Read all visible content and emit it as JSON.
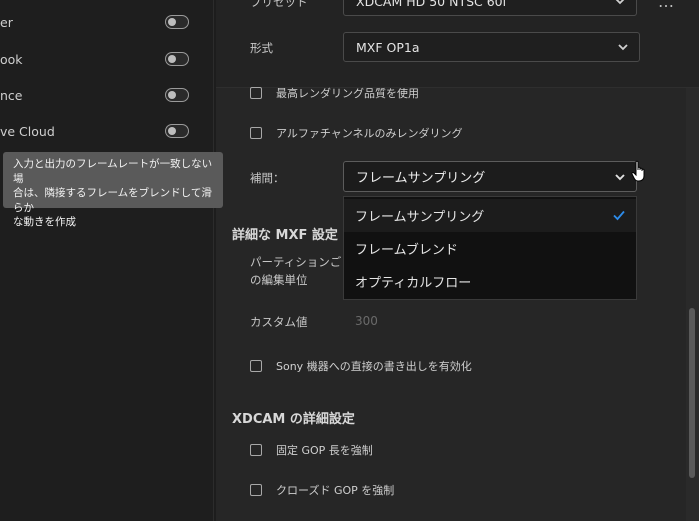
{
  "left_panel": {
    "publish_items": [
      {
        "label": "er"
      },
      {
        "label": "ook"
      },
      {
        "label": "nce"
      },
      {
        "label": "ve Cloud"
      }
    ],
    "tooltip": {
      "line1": "入力と出力のフレームレートが一致しない場",
      "line2": "合は、隣接するフレームをブレンドして滑らか",
      "line3": "な動きを作成"
    }
  },
  "right_panel": {
    "preset": {
      "label": "プリセット",
      "value": "XDCAM HD 50 NTSC 60i"
    },
    "format": {
      "label": "形式",
      "value": "MXF OP1a"
    },
    "more_label": "…",
    "max_render_quality": {
      "label": "最高レンダリング品質を使用",
      "checked": false
    },
    "render_alpha_only": {
      "label": "アルファチャンネルのみレンダリング",
      "checked": false
    },
    "interpolation": {
      "label": "補間：",
      "value": "フレームサンプリング",
      "options": [
        "フレームサンプリング",
        "フレームブレンド",
        "オプティカルフロー"
      ],
      "selected_index": 0
    },
    "mxf_settings": {
      "heading": "詳細な MXF 設定",
      "partition_label_line1": "パーティションごと",
      "partition_label_line2": "の編集単位",
      "custom_label": "カスタム値",
      "custom_value": "300",
      "sony_direct": {
        "label": "Sony 機器への直接の書き出しを有効化",
        "checked": false
      }
    },
    "xdcam_settings": {
      "heading": "XDCAM の詳細設定",
      "force_fixed_gop": {
        "label": "固定 GOP 長を強制",
        "checked": false
      },
      "force_closed_gop": {
        "label": "クローズド GOP を強制",
        "checked": false
      }
    }
  },
  "colors": {
    "accent_check": "#2d8ceb",
    "panel_bg": "#262626",
    "menu_bg": "#111111"
  },
  "icons": {
    "chevron": "chevron-down-icon",
    "check": "checkmark-icon",
    "cursor": "hand-pointer-icon",
    "toggle": "toggle-switch-off"
  }
}
